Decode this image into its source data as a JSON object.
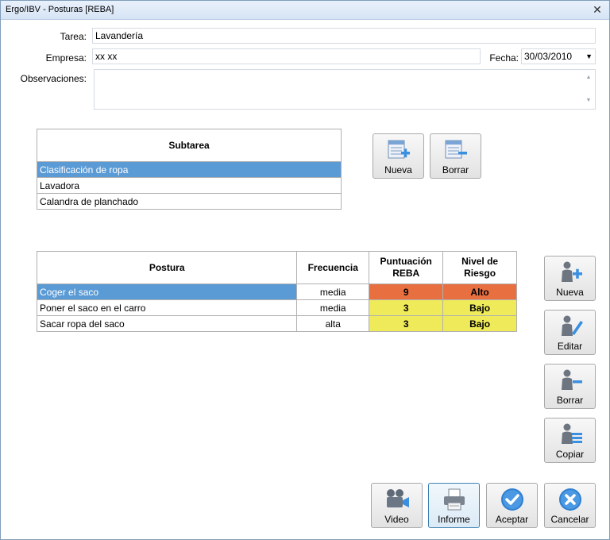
{
  "window": {
    "title": "Ergo/IBV - Posturas [REBA]",
    "close_glyph": "✕"
  },
  "form": {
    "tarea_label": "Tarea:",
    "tarea_value": "Lavandería",
    "empresa_label": "Empresa:",
    "empresa_value": "xx xx",
    "fecha_label": "Fecha:",
    "fecha_value": "30/03/2010",
    "observaciones_label": "Observaciones:",
    "observaciones_value": ""
  },
  "subtareas": {
    "header": "Subtarea",
    "rows": [
      "Clasificación de ropa",
      "Lavadora",
      "Calandra de planchado"
    ],
    "selected_index": 0,
    "buttons": {
      "nueva": "Nueva",
      "borrar": "Borrar"
    }
  },
  "posturas": {
    "headers": {
      "postura": "Postura",
      "frecuencia": "Frecuencia",
      "puntuacion": "Puntuación REBA",
      "nivel": "Nivel de Riesgo"
    },
    "rows": [
      {
        "postura": "Coger el saco",
        "frecuencia": "media",
        "puntuacion": "9",
        "nivel": "Alto"
      },
      {
        "postura": "Poner el saco en el carro",
        "frecuencia": "media",
        "puntuacion": "3",
        "nivel": "Bajo"
      },
      {
        "postura": "Sacar ropa del saco",
        "frecuencia": "alta",
        "puntuacion": "3",
        "nivel": "Bajo"
      }
    ],
    "selected_index": 0,
    "side_buttons": {
      "nueva": "Nueva",
      "editar": "Editar",
      "borrar": "Borrar",
      "copiar": "Copiar"
    }
  },
  "footer": {
    "video": "Video",
    "informe": "Informe",
    "aceptar": "Aceptar",
    "cancelar": "Cancelar"
  },
  "colors": {
    "selection": "#5b9bd5",
    "risk_high": "#e87040",
    "risk_low": "#eeea5a",
    "accent": "#2f7fd0"
  }
}
